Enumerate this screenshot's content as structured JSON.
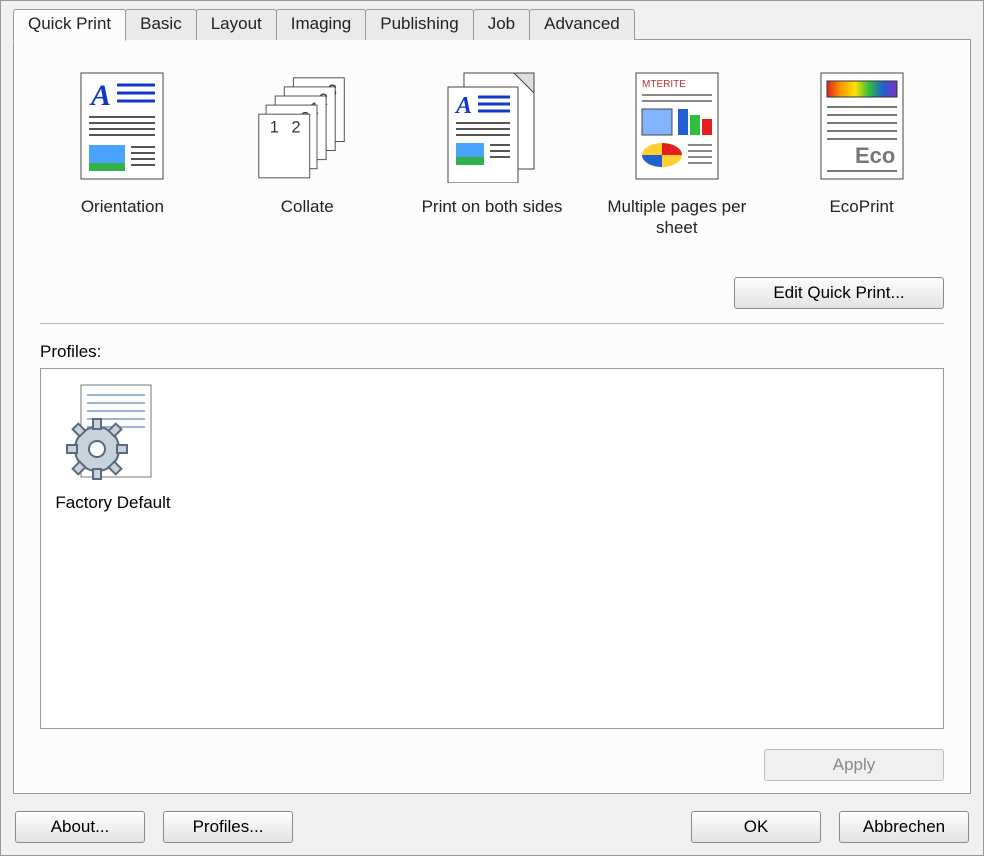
{
  "tabs": [
    {
      "label": "Quick Print",
      "active": true
    },
    {
      "label": "Basic",
      "active": false
    },
    {
      "label": "Layout",
      "active": false
    },
    {
      "label": "Imaging",
      "active": false
    },
    {
      "label": "Publishing",
      "active": false
    },
    {
      "label": "Job",
      "active": false
    },
    {
      "label": "Advanced",
      "active": false
    }
  ],
  "quick_options": {
    "orientation": "Orientation",
    "collate": "Collate",
    "both_sides": "Print on both sides",
    "multi_per_sheet": "Multiple pages per sheet",
    "ecoprint": "EcoPrint"
  },
  "buttons": {
    "edit_quick_print": "Edit Quick Print...",
    "apply": "Apply",
    "about": "About...",
    "profiles": "Profiles...",
    "ok": "OK",
    "cancel": "Abbrechen"
  },
  "profiles": {
    "label": "Profiles:",
    "items": [
      {
        "label": "Factory Default"
      }
    ]
  }
}
